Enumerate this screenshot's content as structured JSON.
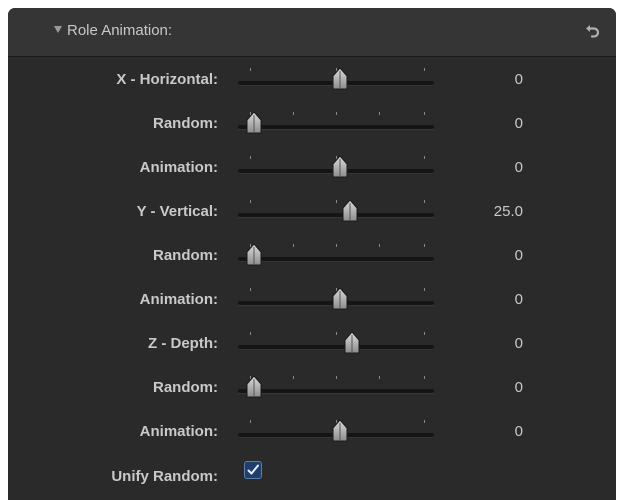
{
  "header": {
    "title": "Role Animation:",
    "disclosure_icon": "triangle-down-icon",
    "reset_icon": "reset-arrow-icon"
  },
  "rows": [
    {
      "label": "X - Horizontal:",
      "value": "0",
      "level": 0.5
    },
    {
      "label": "Random:",
      "value": "0",
      "level": 0.0
    },
    {
      "label": "Animation:",
      "value": "0",
      "level": 0.5
    },
    {
      "label": "Y - Vertical:",
      "value": "25.0",
      "level": 0.56
    },
    {
      "label": "Random:",
      "value": "0",
      "level": 0.0
    },
    {
      "label": "Animation:",
      "value": "0",
      "level": 0.5
    },
    {
      "label": "Z - Depth:",
      "value": "0",
      "level": 0.57
    },
    {
      "label": "Random:",
      "value": "0",
      "level": 0.0
    },
    {
      "label": "Animation:",
      "value": "0",
      "level": 0.5
    }
  ],
  "unify": {
    "label": "Unify Random:",
    "checked": true
  },
  "colors": {
    "panel_bg": "#2a2a2a",
    "text": "#c9c9c9",
    "checkbox_accent": "#1e3f6e"
  }
}
